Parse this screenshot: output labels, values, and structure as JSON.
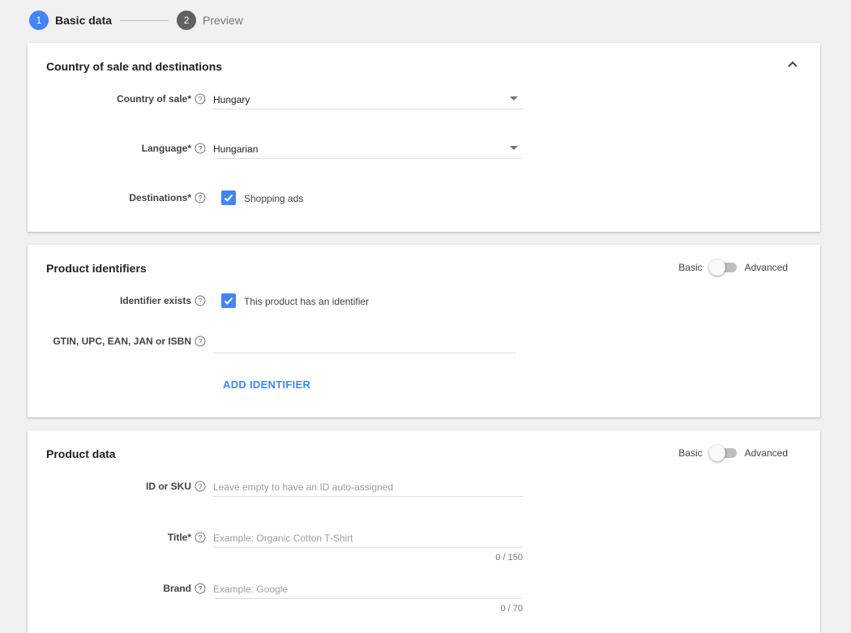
{
  "stepper": {
    "step1": {
      "number": "1",
      "label": "Basic data"
    },
    "step2": {
      "number": "2",
      "label": "Preview"
    }
  },
  "country_card": {
    "title": "Country of sale and destinations",
    "country": {
      "label": "Country of sale*",
      "value": "Hungary"
    },
    "language": {
      "label": "Language*",
      "value": "Hungarian"
    },
    "destinations": {
      "label": "Destinations*",
      "option": "Shopping ads",
      "checked": true
    }
  },
  "identifiers_card": {
    "title": "Product identifiers",
    "toggle": {
      "left": "Basic",
      "right": "Advanced"
    },
    "identifier_exists": {
      "label": "Identifier exists",
      "option": "This product has an identifier",
      "checked": true
    },
    "gtin": {
      "label": "GTIN, UPC, EAN, JAN or ISBN",
      "value": ""
    },
    "add_identifier": "ADD IDENTIFIER"
  },
  "product_card": {
    "title": "Product data",
    "toggle": {
      "left": "Basic",
      "right": "Advanced"
    },
    "id_sku": {
      "label": "ID or SKU",
      "placeholder": "Leave empty to have an ID auto-assigned"
    },
    "title_field": {
      "label": "Title*",
      "placeholder": "Example: Organic Cotton T-Shirt",
      "counter": "0 / 150"
    },
    "brand": {
      "label": "Brand",
      "placeholder": "Example: Google",
      "counter": "0 / 70"
    }
  },
  "colors": {
    "accent": "#4285f4",
    "inactive_step": "#616161"
  }
}
